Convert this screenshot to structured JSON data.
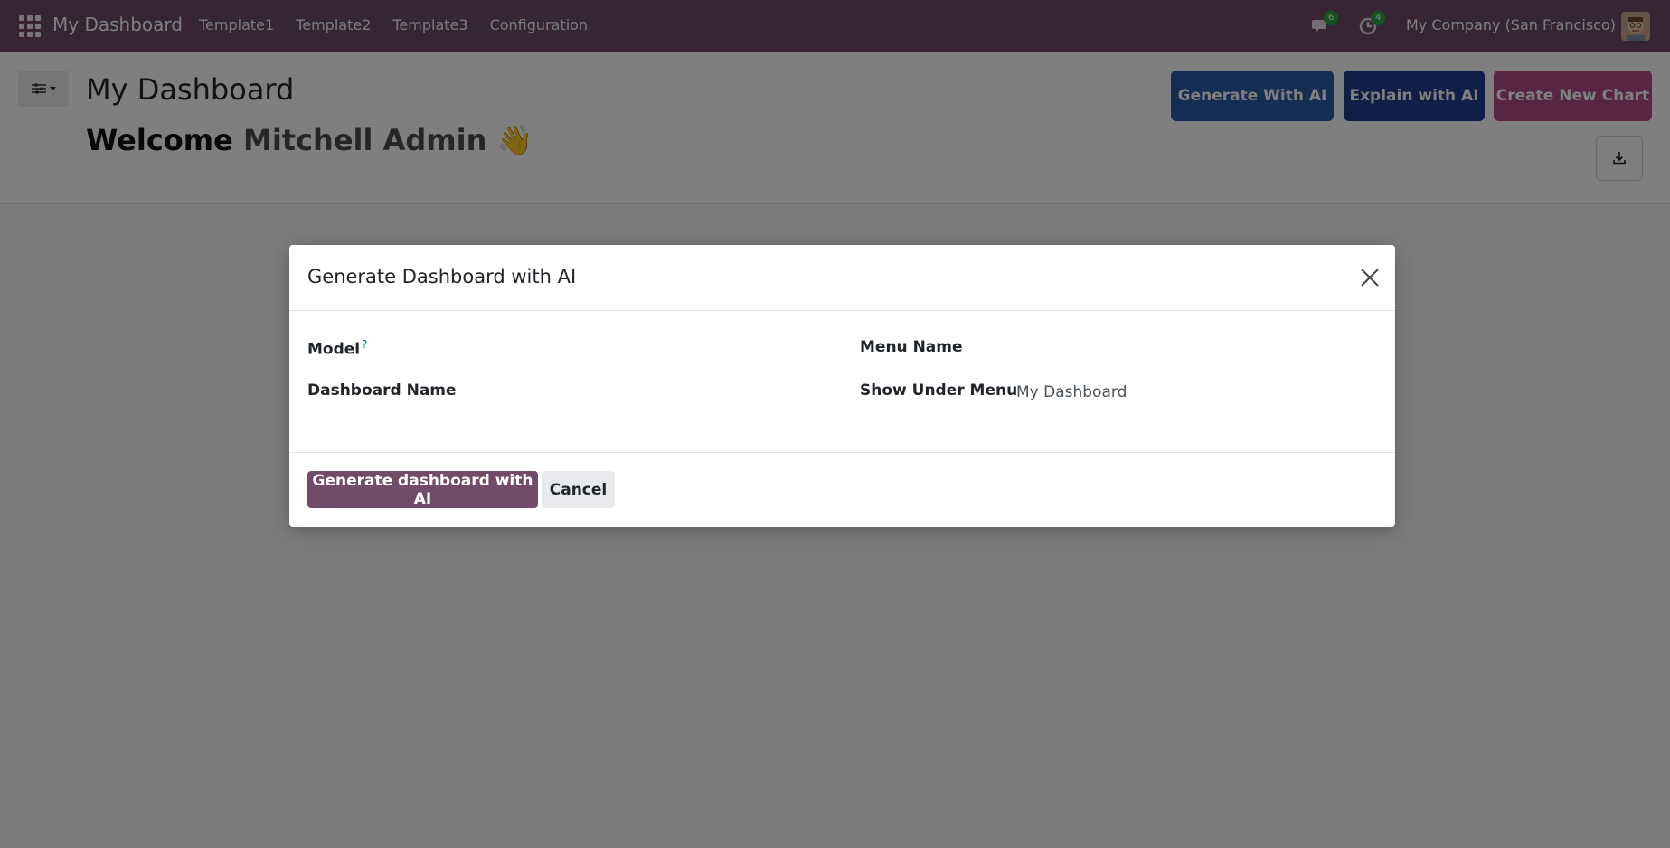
{
  "navbar": {
    "brand": "My Dashboard",
    "menu": [
      "Template1",
      "Template2",
      "Template3",
      "Configuration"
    ],
    "messages_count": "6",
    "activities_count": "4",
    "company": "My Company (San Francisco)"
  },
  "control_panel": {
    "title": "My Dashboard",
    "welcome_prefix": "Welcome",
    "user_name": "Mitchell Admin",
    "welcome_emoji": "👋",
    "buttons": {
      "generate_ai": "Generate With AI",
      "explain_ai": "Explain with AI",
      "create_chart": "Create New Chart"
    }
  },
  "modal": {
    "title": "Generate Dashboard with AI",
    "fields": {
      "model_label": "Model",
      "model_help": "?",
      "model_value": "",
      "menu_name_label": "Menu Name",
      "menu_name_value": "",
      "dashboard_name_label": "Dashboard Name",
      "dashboard_name_value": "",
      "show_under_menu_label": "Show Under Menu",
      "show_under_menu_value": "My Dashboard"
    },
    "footer": {
      "primary": "Generate dashboard with AI",
      "cancel": "Cancel"
    }
  },
  "colors": {
    "navbar": "#714b67",
    "primary": "#714b67",
    "generate_ai": "#2c5ca8",
    "explain_ai": "#1f3f8f",
    "create_chart": "#b04b86"
  }
}
